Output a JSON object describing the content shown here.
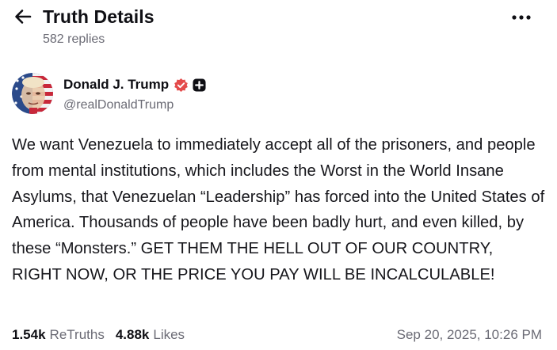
{
  "header": {
    "title": "Truth Details",
    "subtitle": "582 replies",
    "back_icon": "arrow-left-icon",
    "more_icon": "more-horizontal-icon"
  },
  "author": {
    "name": "Donald J. Trump",
    "handle": "@realDonaldTrump",
    "verified_icon": "verified-badge-icon",
    "verified_color": "#e44b4b",
    "plus_icon": "plus-badge-icon"
  },
  "post": {
    "text": "We want Venezuela to immediately accept all of the prisoners, and people from mental institutions, which includes the Worst in the World Insane Asylums, that Venezuelan “Leadership” has forced into the United States of America. Thousands of people have been badly hurt, and even killed, by these “Monsters.” GET THEM THE HELL OUT OF OUR COUNTRY, RIGHT NOW, OR THE PRICE YOU PAY WILL BE INCALCULABLE!"
  },
  "stats": {
    "retruths_count": "1.54k",
    "retruths_label": "ReTruths",
    "likes_count": "4.88k",
    "likes_label": "Likes"
  },
  "timestamp": "Sep 20, 2025, 10:26 PM",
  "colors": {
    "text_primary": "#0f0f14",
    "text_secondary": "#6b6b75",
    "accent_red": "#e44b4b"
  }
}
